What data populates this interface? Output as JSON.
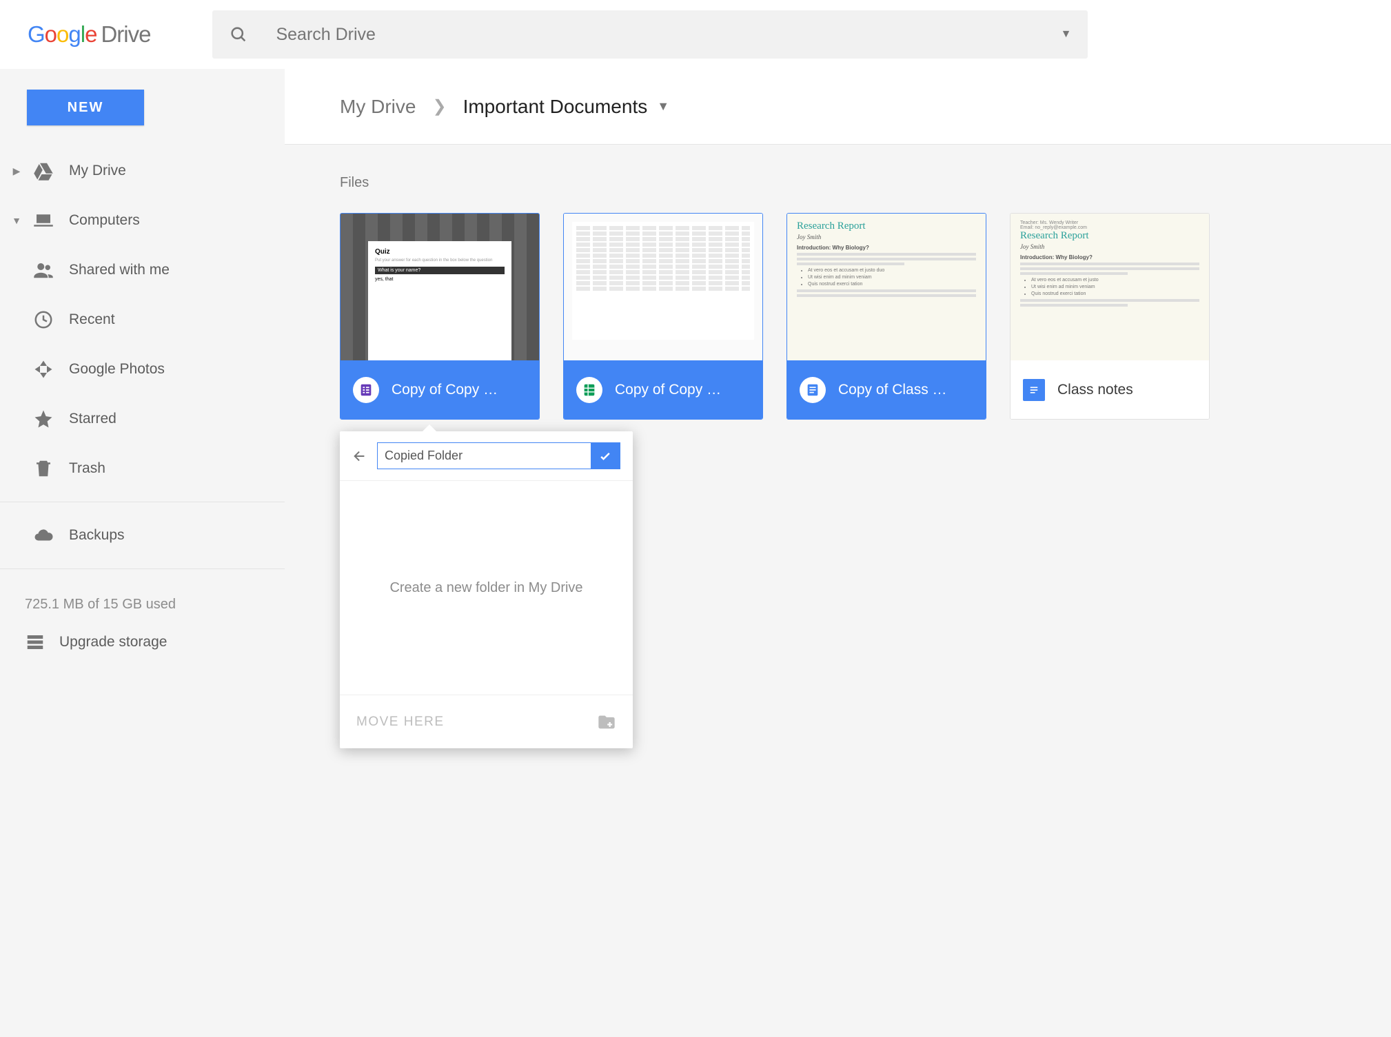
{
  "header": {
    "logo_product": "Drive",
    "search_placeholder": "Search Drive"
  },
  "toolbar": {
    "new_label": "NEW"
  },
  "sidebar": {
    "items": [
      {
        "label": "My Drive",
        "icon": "drive"
      },
      {
        "label": "Computers",
        "icon": "laptop"
      },
      {
        "label": "Shared with me",
        "icon": "people"
      },
      {
        "label": "Recent",
        "icon": "clock"
      },
      {
        "label": "Google Photos",
        "icon": "photos"
      },
      {
        "label": "Starred",
        "icon": "star"
      },
      {
        "label": "Trash",
        "icon": "trash"
      }
    ],
    "backups_label": "Backups",
    "storage_text": "725.1 MB of 15 GB used",
    "upgrade_label": "Upgrade storage"
  },
  "breadcrumb": {
    "root": "My Drive",
    "current": "Important Documents"
  },
  "content": {
    "section_label": "Files",
    "files": [
      {
        "name": "Copy of Copy …",
        "type": "forms",
        "selected": true
      },
      {
        "name": "Copy of Copy …",
        "type": "sheets",
        "selected": true
      },
      {
        "name": "Copy of Class …",
        "type": "docs",
        "selected": true
      },
      {
        "name": "Class notes",
        "type": "docs",
        "selected": false
      }
    ],
    "doc_preview": {
      "title": "Research Report",
      "author": "Joy Smith",
      "section": "Introduction: Why Biology?"
    }
  },
  "move_popup": {
    "input_value": "Copied Folder",
    "body_text": "Create a new folder in My Drive",
    "action_label": "MOVE HERE"
  }
}
